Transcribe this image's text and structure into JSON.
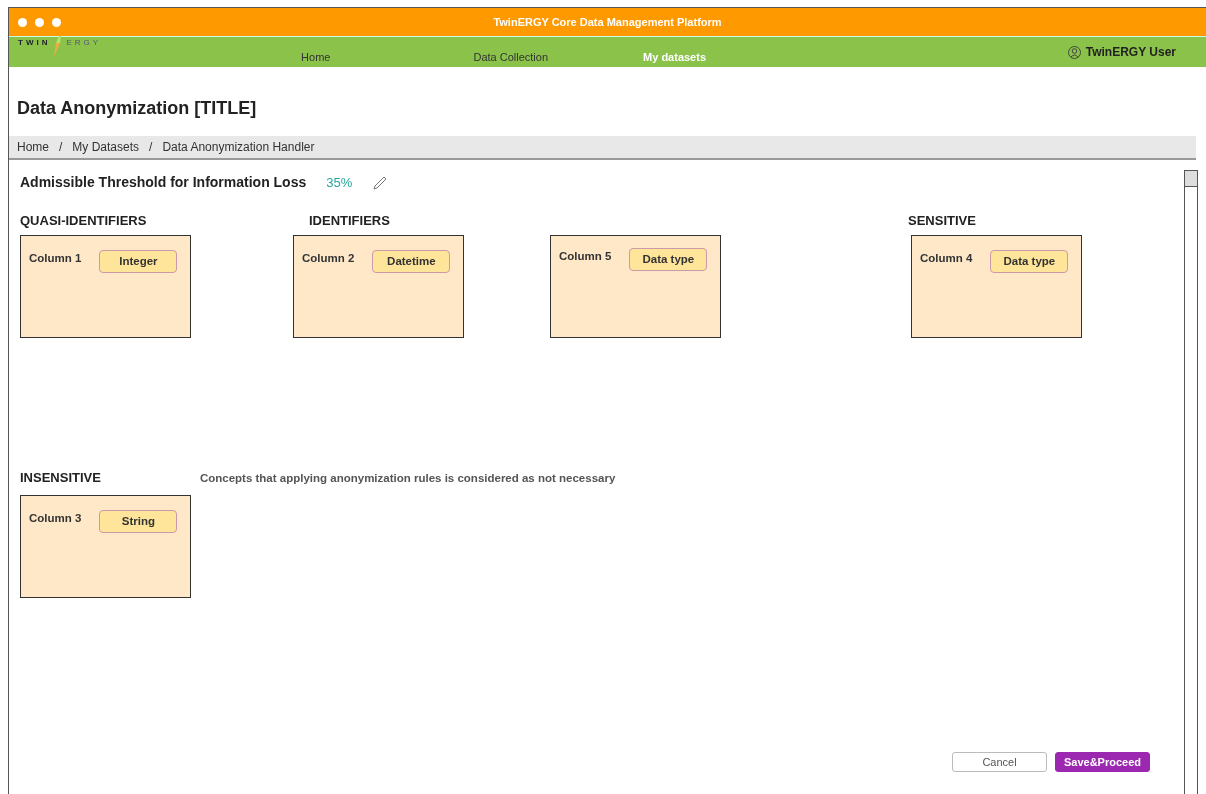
{
  "window": {
    "title": "TwinERGY Core Data Management Platform"
  },
  "logo": {
    "left": "TWIN",
    "right": "ERGY"
  },
  "nav": [
    {
      "label": "Home",
      "selected": false
    },
    {
      "label": "Data Collection",
      "selected": false
    },
    {
      "label": "My datasets",
      "selected": true
    }
  ],
  "user": "TwinERGY User",
  "page_title": "Data Anonymization [TITLE]",
  "breadcrumb": [
    "Home",
    "My Datasets",
    "Data Anonymization Handler"
  ],
  "breadcrumb_separator": "/",
  "threshold": {
    "label": "Admissible Threshold for Information Loss",
    "value": "35%"
  },
  "groups": [
    {
      "title": "QUASI-IDENTIFIERS",
      "columns": [
        {
          "name": "Column 1",
          "type": "Integer"
        }
      ]
    },
    {
      "title": "IDENTIFIERS",
      "columns": [
        {
          "name": "Column 2",
          "type": "Datetime"
        },
        {
          "name": "Column 5",
          "type": "Data type"
        }
      ]
    },
    {
      "title": "SENSITIVE",
      "columns": [
        {
          "name": "Column 4",
          "type": "Data type"
        }
      ]
    }
  ],
  "insensitive": {
    "title": "INSENSITIVE",
    "note": "Concepts that applying anonymization rules is considered as not necessary",
    "columns": [
      {
        "name": "Column 3",
        "type": "String"
      }
    ]
  },
  "buttons": [
    {
      "label": "Cancel",
      "kind": "secondary"
    },
    {
      "label": "Save&Proceed",
      "kind": "primary"
    }
  ]
}
